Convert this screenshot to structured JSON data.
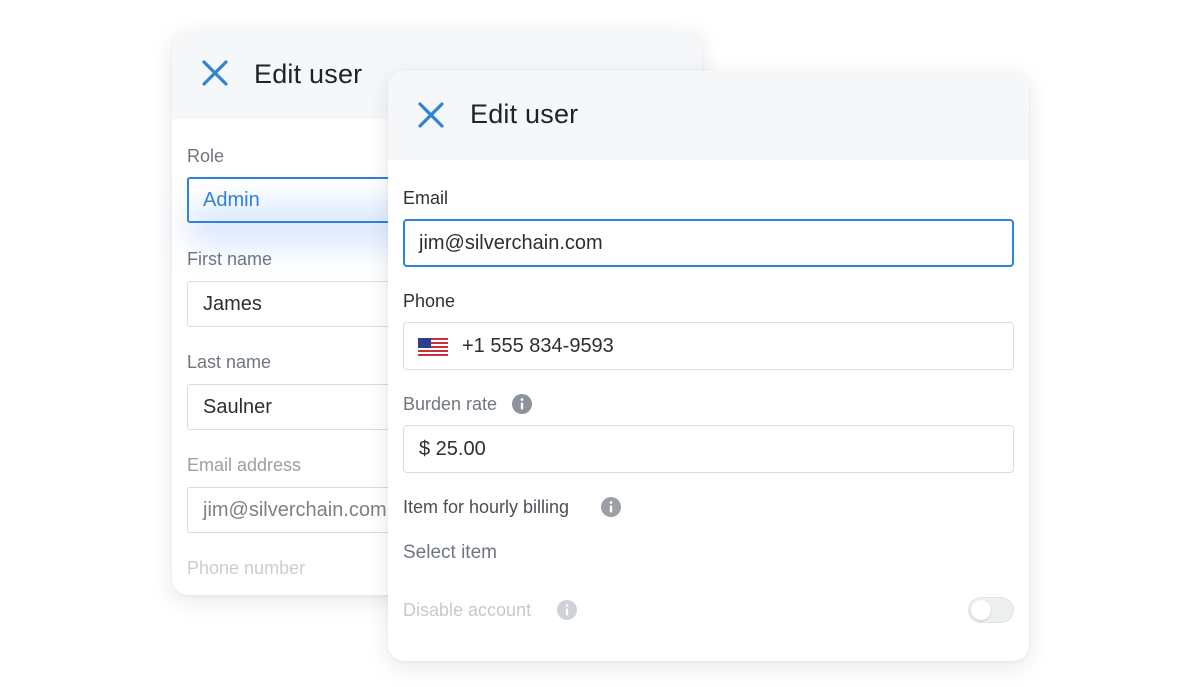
{
  "colors": {
    "accent": "#2f83d6",
    "header_bg": "#f5f7f9",
    "border": "#d9dde1"
  },
  "back_card": {
    "title": "Edit user",
    "close_icon": "close-icon",
    "role": {
      "label": "Role",
      "value": "Admin"
    },
    "first_name": {
      "label": "First name",
      "value": "James"
    },
    "last_name": {
      "label": "Last name",
      "value": "Saulner"
    },
    "email": {
      "label": "Email address",
      "value": "jim@silverchain.com"
    },
    "phone": {
      "label": "Phone number"
    }
  },
  "front_card": {
    "title": "Edit user",
    "close_icon": "close-icon",
    "email": {
      "label": "Email",
      "value": "jim@silverchain.com"
    },
    "phone": {
      "label": "Phone",
      "value": "+1 555 834-9593",
      "flag_icon": "us-flag-icon"
    },
    "burden_rate": {
      "label": "Burden rate",
      "value": "$ 25.00",
      "info_icon": "info-icon"
    },
    "hourly_billing": {
      "label": "Item for hourly billing",
      "placeholder": "Select item",
      "info_icon": "info-icon"
    },
    "disable_account": {
      "label": "Disable account",
      "info_icon": "info-icon",
      "enabled": false
    }
  }
}
